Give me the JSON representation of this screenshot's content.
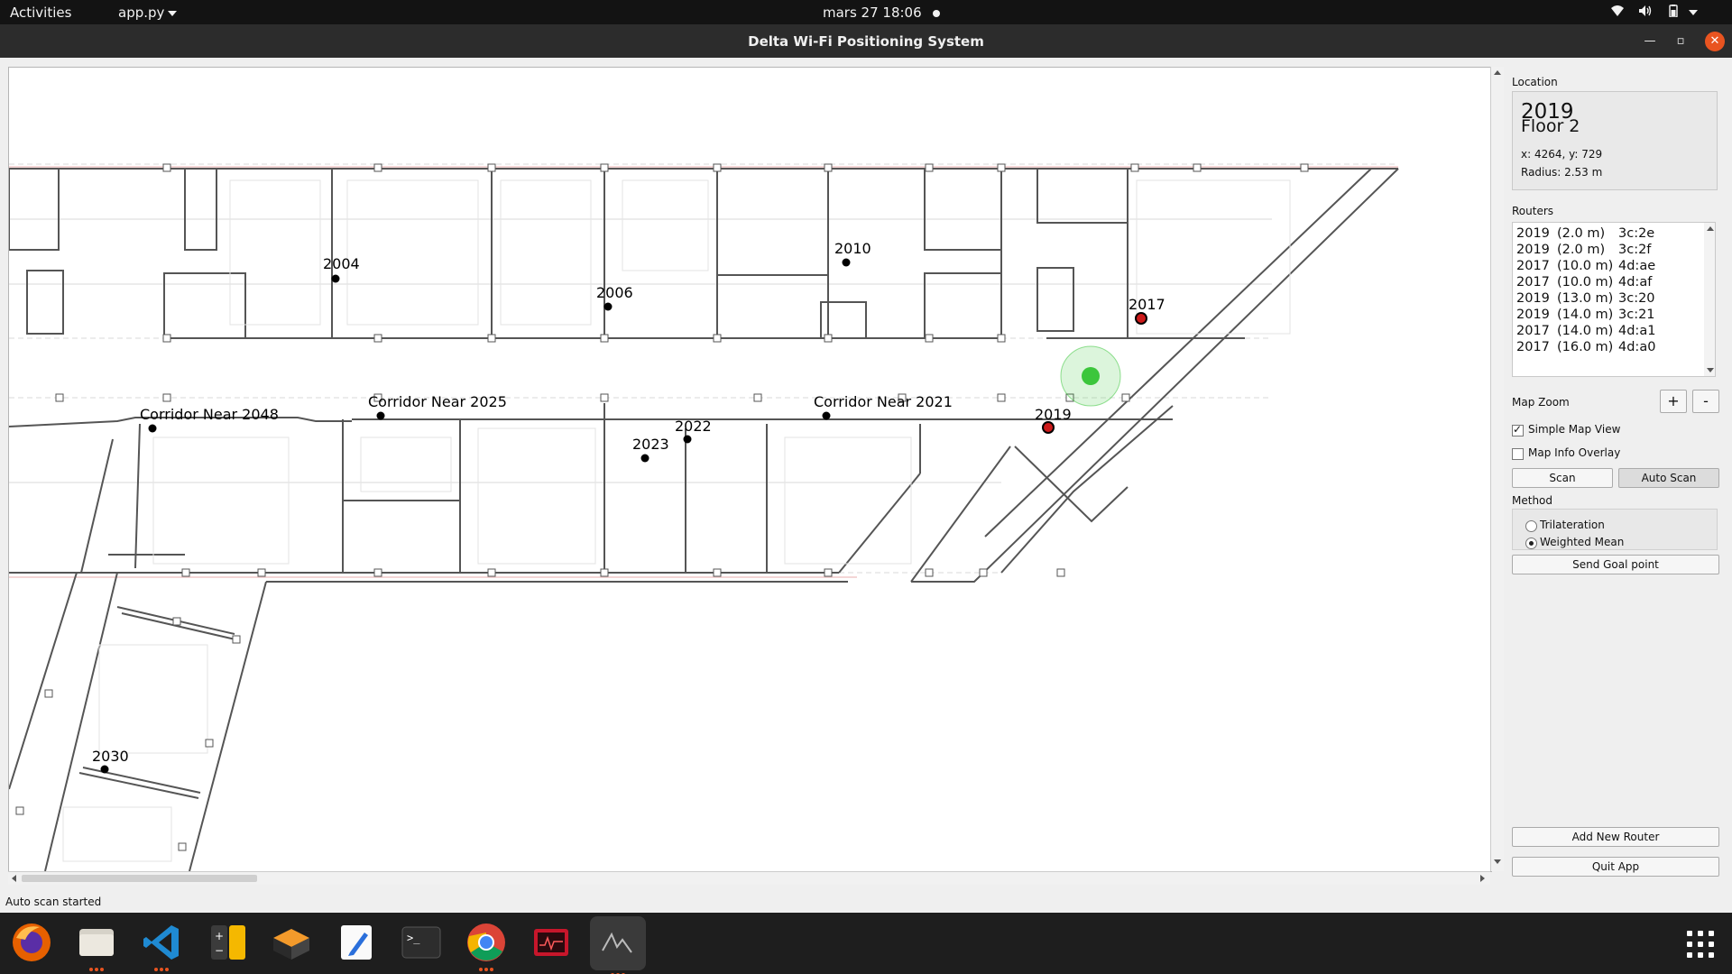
{
  "topbar": {
    "activities": "Activities",
    "app_menu": "app.py",
    "clock": "mars 27  18:06"
  },
  "window": {
    "title": "Delta Wi-Fi Positioning System"
  },
  "map": {
    "labels": [
      {
        "id": "2004",
        "text": "2004"
      },
      {
        "id": "2006",
        "text": "2006"
      },
      {
        "id": "2010",
        "text": "2010"
      },
      {
        "id": "2017",
        "text": "2017"
      },
      {
        "id": "2019",
        "text": "2019"
      },
      {
        "id": "2022",
        "text": "2022"
      },
      {
        "id": "2023",
        "text": "2023"
      },
      {
        "id": "2030",
        "text": "2030"
      },
      {
        "id": "c2048",
        "text": "Corridor Near 2048"
      },
      {
        "id": "c2025",
        "text": "Corridor Near 2025"
      },
      {
        "id": "c2021",
        "text": "Corridor Near 2021"
      }
    ],
    "estimate_color": "#3cc63c",
    "router_color": "#cc1a1a"
  },
  "panel": {
    "location_label": "Location",
    "location": {
      "name": "2019",
      "floor": "Floor 2",
      "coords": "x: 4264, y: 729",
      "radius": "Radius: 2.53 m"
    },
    "routers_label": "Routers",
    "routers": [
      {
        "room": "2019",
        "dist": "(2.0 m)",
        "mac": "3c:2e"
      },
      {
        "room": "2019",
        "dist": "(2.0 m)",
        "mac": "3c:2f"
      },
      {
        "room": "2017",
        "dist": "(10.0 m)",
        "mac": "4d:ae"
      },
      {
        "room": "2017",
        "dist": "(10.0 m)",
        "mac": "4d:af"
      },
      {
        "room": "2019",
        "dist": "(13.0 m)",
        "mac": "3c:20"
      },
      {
        "room": "2019",
        "dist": "(14.0 m)",
        "mac": "3c:21"
      },
      {
        "room": "2017",
        "dist": "(14.0 m)",
        "mac": "4d:a1"
      },
      {
        "room": "2017",
        "dist": "(16.0 m)",
        "mac": "4d:a0"
      }
    ],
    "map_zoom_label": "Map Zoom",
    "zoom_in": "+",
    "zoom_out": "-",
    "simple_map_view": "Simple Map View",
    "simple_map_view_checked": true,
    "map_info_overlay": "Map Info Overlay",
    "map_info_overlay_checked": false,
    "scan_button": "Scan",
    "auto_scan_button": "Auto Scan",
    "method_label": "Method",
    "method_options": [
      "Trilateration",
      "Weighted Mean"
    ],
    "method_selected": "Weighted Mean",
    "send_goal_button": "Send Goal point",
    "add_router_button": "Add New Router",
    "quit_button": "Quit App"
  },
  "status": "Auto scan started"
}
